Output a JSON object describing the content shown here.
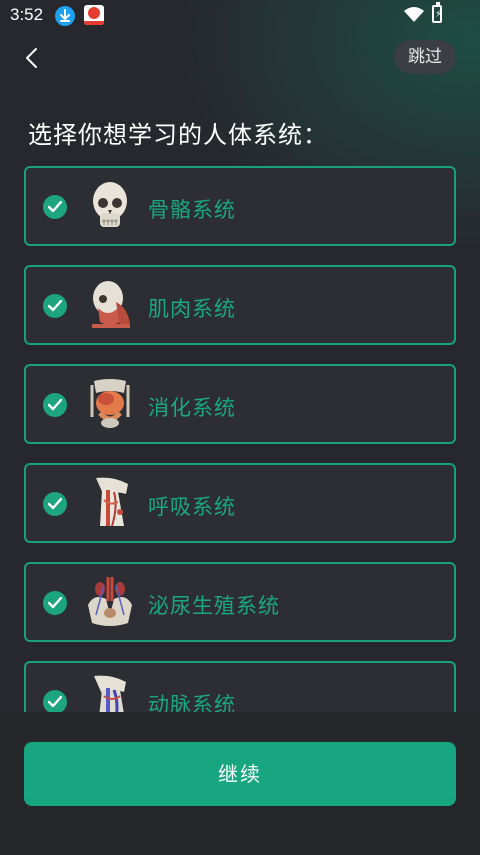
{
  "status_bar": {
    "time": "3:52"
  },
  "header": {
    "skip_label": "跳过"
  },
  "title": "选择你想学习的人体系统：",
  "systems": [
    {
      "label": "骨骼系统",
      "thumb_icon": "skull-icon"
    },
    {
      "label": "肌肉系统",
      "thumb_icon": "head-muscle-icon"
    },
    {
      "label": "消化系统",
      "thumb_icon": "digestive-organs-icon"
    },
    {
      "label": "呼吸系统",
      "thumb_icon": "neck-airway-icon"
    },
    {
      "label": "泌尿生殖系统",
      "thumb_icon": "pelvis-icon"
    },
    {
      "label": "动脉系统",
      "thumb_icon": "artery-icon"
    }
  ],
  "continue_label": "继续",
  "colors": {
    "accent": "#17a67f",
    "background": "#27282d",
    "card": "#2c2e33"
  }
}
